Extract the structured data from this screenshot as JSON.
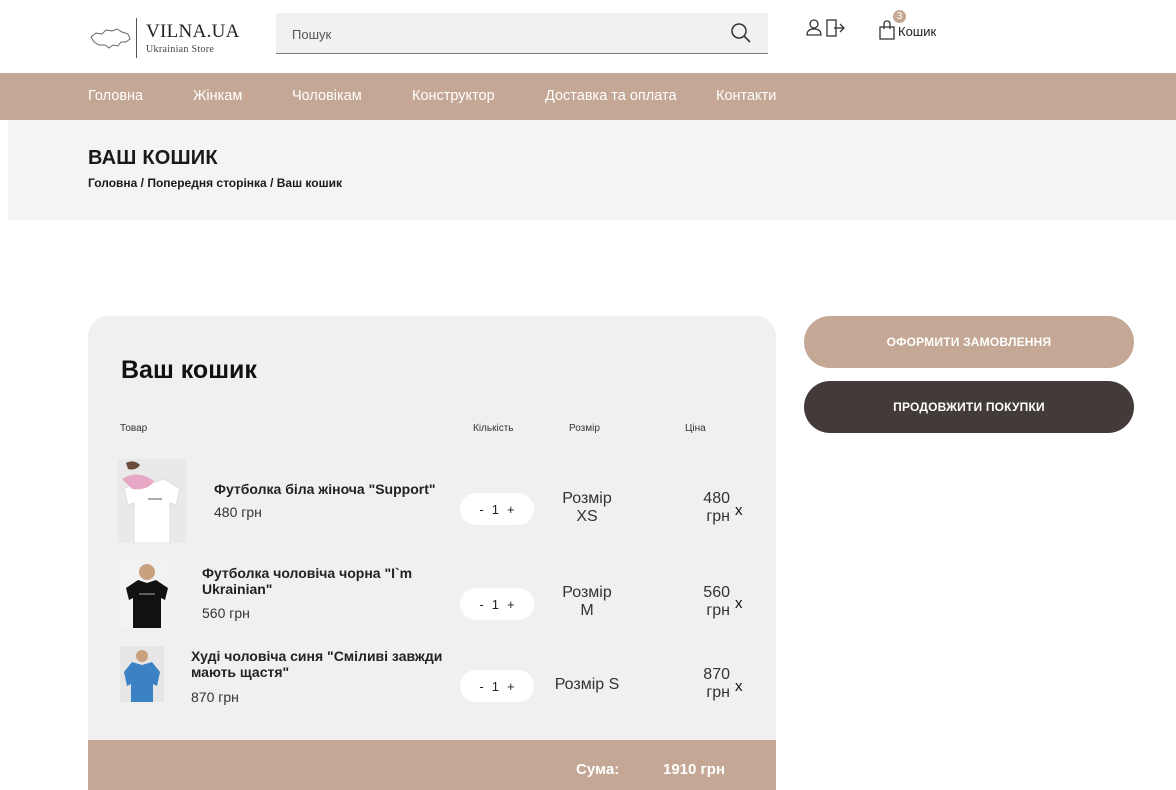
{
  "header": {
    "logo_title": "VILNA.UA",
    "logo_subtitle": "Ukrainian Store",
    "search_placeholder": "Пошук",
    "cart_badge": "3",
    "cart_label": "Кошик"
  },
  "nav": {
    "items": [
      {
        "label": "Головна"
      },
      {
        "label": "Жінкам"
      },
      {
        "label": "Чоловікам"
      },
      {
        "label": "Конструктор"
      },
      {
        "label": "Доставка та оплата"
      },
      {
        "label": "Контакти"
      }
    ]
  },
  "page": {
    "title": "ВАШ КОШИК",
    "breadcrumb": "Головна / Попередня сторінка / Ваш кошик"
  },
  "cart": {
    "title": "Ваш кошик",
    "columns": {
      "product": "Товар",
      "quantity": "Кількість",
      "size": "Розмір",
      "price": "Ціна"
    },
    "items": [
      {
        "name": "Футболка біла жіноча \"Support\"",
        "unit_price": "480 грн",
        "quantity": "1",
        "size_line1": "Розмір",
        "size_line2": "XS",
        "price_line1": "480",
        "price_line2": "грн",
        "image_icon": "white-tshirt-photo"
      },
      {
        "name_line1": "Футболка чоловіча чорна \"I`m",
        "name_line2": "Ukrainian\"",
        "unit_price": "560 грн",
        "quantity": "1",
        "size_line1": "Розмір",
        "size_line2": "M",
        "price_line1": "560",
        "price_line2": "грн",
        "image_icon": "black-tshirt-photo"
      },
      {
        "name_line1": "Худі чоловіча синя \"Сміливі завжди",
        "name_line2": "мають щастя\"",
        "unit_price": "870 грн",
        "quantity": "1",
        "size_line1": "Розмір S",
        "price_line1": "870",
        "price_line2": "грн",
        "image_icon": "blue-hoodie-photo"
      }
    ],
    "minus": "-",
    "plus": "+",
    "remove": "x",
    "total_label": "Сума:",
    "total_value": "1910 грн"
  },
  "actions": {
    "order": "ОФОРМИТИ ЗАМОВЛЕННЯ",
    "continue": "ПРОДОВЖИТИ ПОКУПКИ"
  },
  "colors": {
    "accent": "#c4a794",
    "dark_button": "#433b3a",
    "card_bg": "#f0f0f0",
    "band_bg": "#f4f4f4"
  }
}
